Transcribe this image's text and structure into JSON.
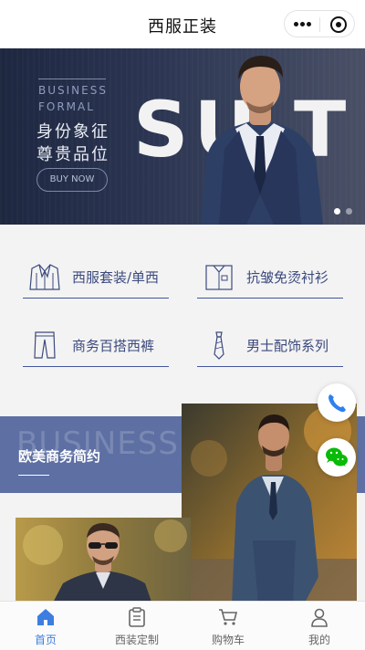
{
  "header": {
    "title": "西服正装"
  },
  "banner": {
    "tagline_en_1": "BUSINESS",
    "tagline_en_2": "FORMAL",
    "tagline_cn_1": "身份象征",
    "tagline_cn_2": "尊贵品位",
    "cta_label": "BUY NOW",
    "big_text": "SU  T",
    "slide_count": 2,
    "active_slide": 1
  },
  "categories": [
    {
      "label": "西服套装/单西",
      "icon": "suit-jacket-icon"
    },
    {
      "label": "抗皱免烫衬衫",
      "icon": "shirt-icon"
    },
    {
      "label": "商务百搭西裤",
      "icon": "trousers-icon"
    },
    {
      "label": "男士配饰系列",
      "icon": "tie-icon"
    }
  ],
  "section": {
    "ghost_text": "BUSINESS",
    "title": "欧美商务简约"
  },
  "floating": {
    "phone_icon": "phone-icon",
    "wechat_icon": "wechat-icon"
  },
  "tabbar": {
    "items": [
      {
        "label": "首页",
        "icon": "home-icon",
        "active": true
      },
      {
        "label": "西装定制",
        "icon": "clipboard-icon",
        "active": false
      },
      {
        "label": "购物车",
        "icon": "cart-icon",
        "active": false
      },
      {
        "label": "我的",
        "icon": "user-icon",
        "active": false
      }
    ]
  },
  "colors": {
    "accent_blue": "#3d7ee0",
    "navy_text": "#3c4a7e",
    "band_blue": "#5d6fa3",
    "phone_blue": "#2f7ff1",
    "wechat_green": "#09bb07"
  }
}
